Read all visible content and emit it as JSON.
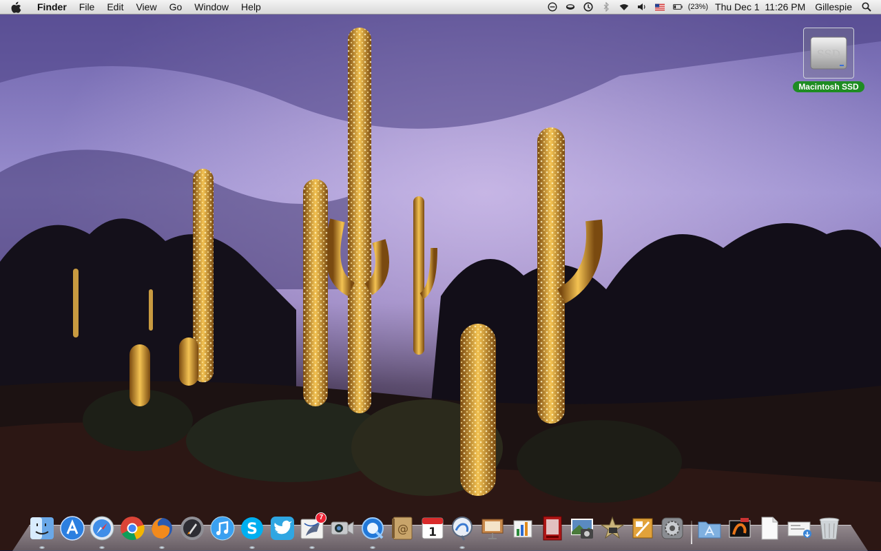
{
  "menubar": {
    "app_name": "Finder",
    "menus": [
      "File",
      "Edit",
      "View",
      "Go",
      "Window",
      "Help"
    ],
    "battery_percent": "(23%)",
    "datetime": "Thu Dec 1  11:26 PM",
    "user": "Gillespie",
    "status_icons": [
      "timemachine-icon",
      "coffee-icon",
      "sync-icon",
      "bluetooth-icon",
      "wifi-icon",
      "volume-icon",
      "us-flag-icon",
      "battery-icon",
      "spotlight-icon"
    ]
  },
  "desktop": {
    "drive_label": "Macintosh SSD",
    "drive_badge": "SSD"
  },
  "dock": {
    "badges": {
      "mail": "7"
    },
    "calendar_day": "1",
    "apps": [
      "Finder",
      "App Store",
      "Safari",
      "Chrome",
      "Firefox",
      "Launchpad",
      "iTunes",
      "Skype",
      "Twitter",
      "Mail",
      "FaceTime",
      "QuickTime",
      "Address Book",
      "iCal",
      "Preview",
      "Keynote",
      "Numbers",
      "Photo Booth",
      "iPhoto",
      "iMovie",
      "Pages",
      "System Preferences"
    ],
    "stack": [
      "Applications",
      "Preview Stack",
      "Documents",
      "Downloads",
      "Trash"
    ]
  }
}
